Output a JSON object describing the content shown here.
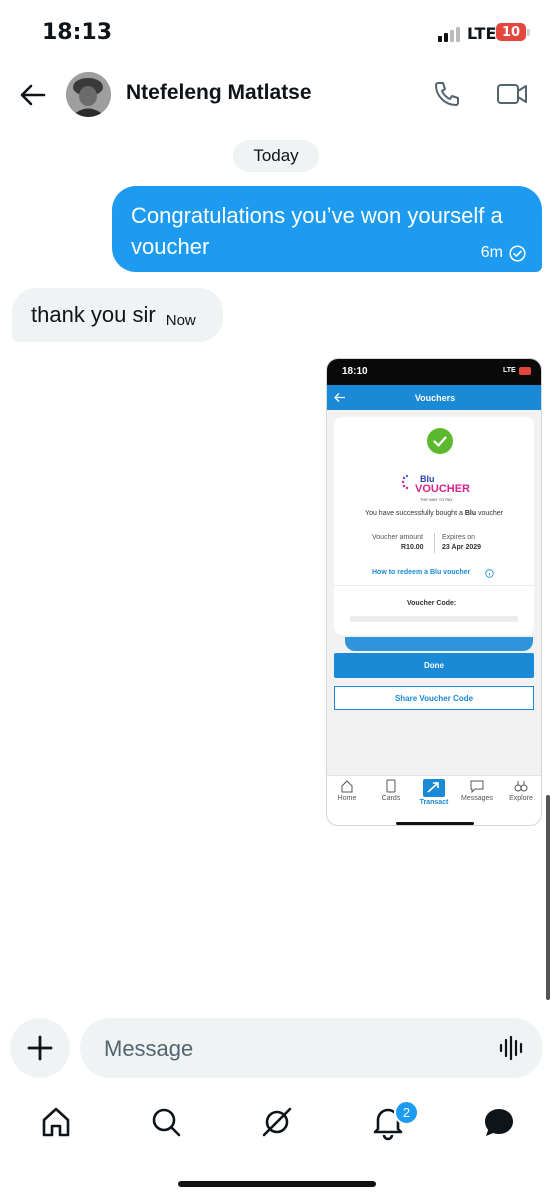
{
  "status_bar": {
    "time": "18:13",
    "network": "LTE",
    "battery": "10"
  },
  "header": {
    "contact_name": "Ntefeleng Matlatse",
    "back_icon": "arrow-left-icon",
    "call_icon": "phone-icon",
    "video_icon": "video-camera-icon"
  },
  "conversation": {
    "date_divider": "Today",
    "messages": [
      {
        "direction": "sent",
        "text": "Congratulations you’ve won yourself a voucher",
        "time": "6m",
        "status_icon": "read-check-icon"
      },
      {
        "direction": "received",
        "text": "thank you sir",
        "time": "Now"
      }
    ],
    "attachment": {
      "status_time": "18:10",
      "status_network": "LTE",
      "title": "Vouchers",
      "brand_line1": "Blu",
      "brand_line2": "VOUCHER",
      "brand_tagline": "THE WAY TO PAY",
      "success_prefix": "You have successfully bought a ",
      "success_brand": "Blu",
      "success_suffix": " voucher",
      "amount_label": "Voucher amount",
      "amount_value": "R10.00",
      "expires_label": "Expires on",
      "expires_value": "23 Apr 2029",
      "redeem_link": "How to redeem a Blu voucher",
      "code_label": "Voucher Code:",
      "done_label": "Done",
      "share_label": "Share Voucher Code",
      "nav": [
        "Home",
        "Cards",
        "Transact",
        "Messages",
        "Explore"
      ],
      "active_nav": "Transact",
      "colors": {
        "accent": "#1a8ad6",
        "brand_pink": "#d6248c",
        "success": "#5cb82e"
      }
    }
  },
  "composer": {
    "placeholder": "Message",
    "plus_icon": "plus-icon",
    "voice_icon": "voice-waveform-icon"
  },
  "bottom_nav": {
    "items": [
      "home-icon",
      "search-icon",
      "grok-icon",
      "notifications-icon",
      "messages-icon"
    ],
    "notification_count": "2"
  },
  "colors": {
    "sent_bubble": "#1d9bf0",
    "received_bubble": "#eff3f4",
    "text": "#0f1419"
  }
}
